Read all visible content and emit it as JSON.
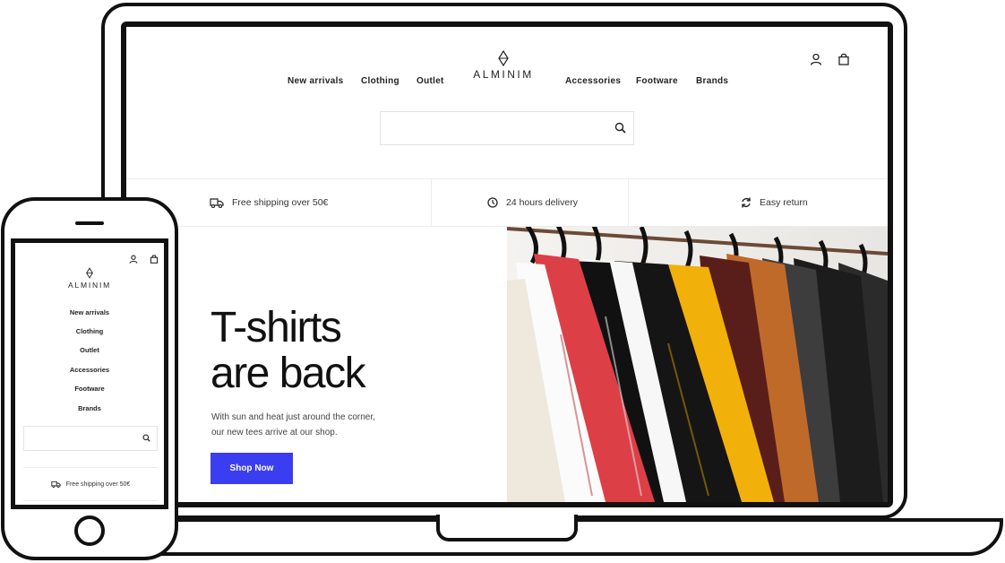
{
  "brand": {
    "name": "ALMINIM"
  },
  "nav": {
    "items": [
      "New arrivals",
      "Clothing",
      "Outlet",
      "Accessories",
      "Footware",
      "Brands"
    ]
  },
  "search": {
    "placeholder": ""
  },
  "features": [
    {
      "label": "Free shipping over 50€",
      "icon": "truck-icon"
    },
    {
      "label": "24 hours delivery",
      "icon": "clock-icon"
    },
    {
      "label": "Easy return",
      "icon": "refresh-icon"
    }
  ],
  "hero": {
    "title_line1": "T-shirts",
    "title_line2": "are back",
    "text": "With sun and heat just around the corner, our new tees arrive at our shop.",
    "button_label": "Shop Now",
    "accent_color": "#3b3df0"
  },
  "mobile": {
    "feature_label": "Free shipping over 50€"
  }
}
